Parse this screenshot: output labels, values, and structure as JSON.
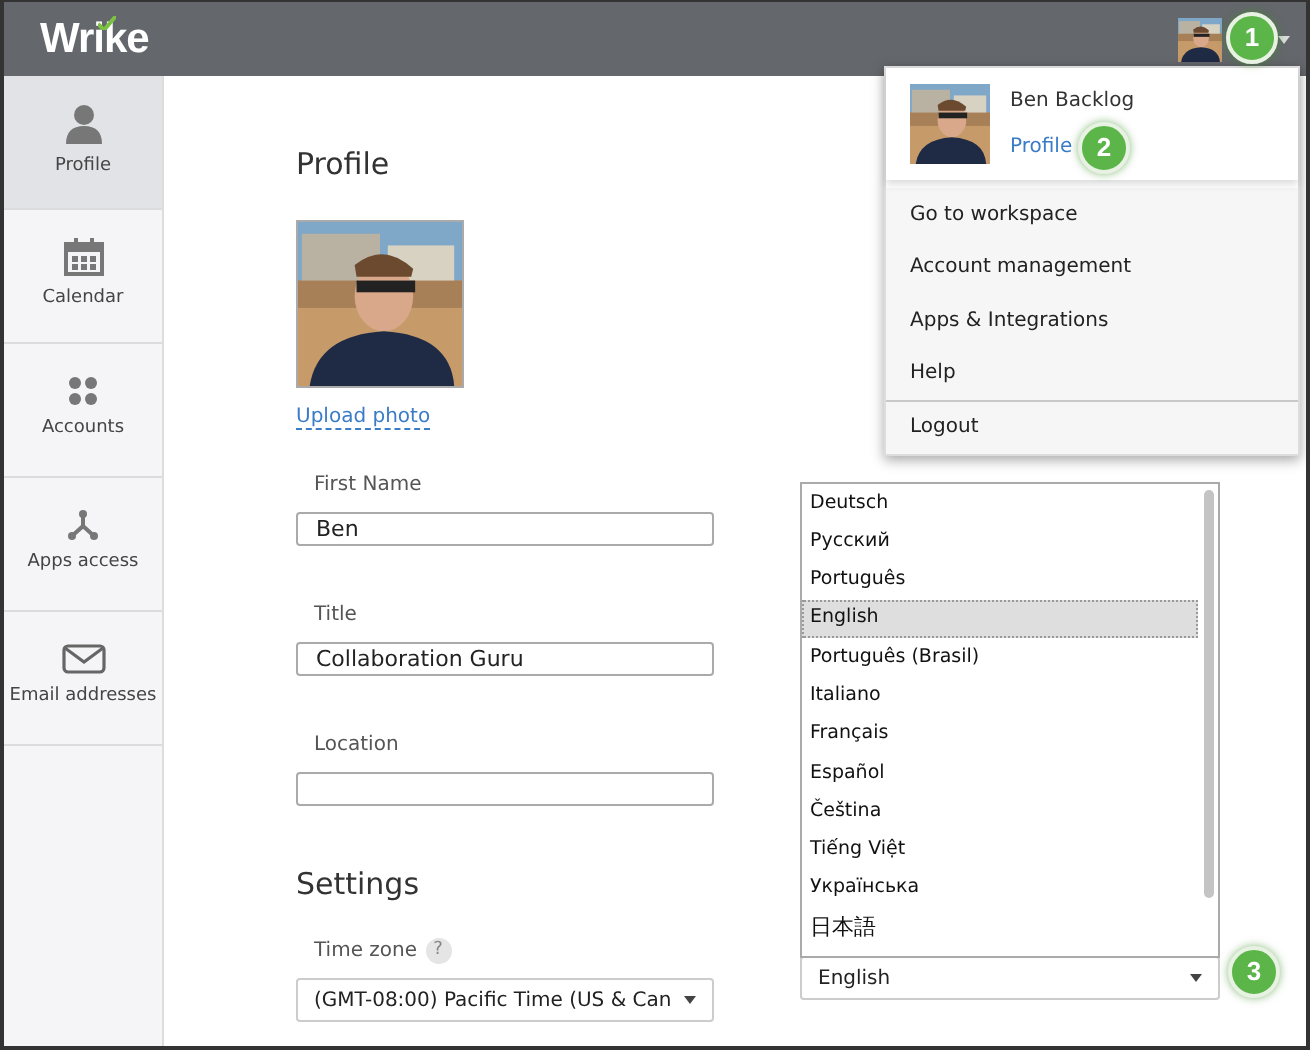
{
  "header": {
    "logo": "Wrike"
  },
  "sidebar": {
    "items": [
      {
        "label": "Profile",
        "kind": "person",
        "selected": true
      },
      {
        "label": "Calendar",
        "kind": "calendar",
        "selected": false
      },
      {
        "label": "Accounts",
        "kind": "dots",
        "selected": false
      },
      {
        "label": "Apps access",
        "kind": "apps",
        "selected": false
      },
      {
        "label": "Email addresses",
        "kind": "mail",
        "selected": false
      }
    ]
  },
  "profile": {
    "heading": "Profile",
    "upload_link": "Upload photo",
    "fields": [
      {
        "label": "First Name",
        "value": "Ben"
      },
      {
        "label": "Title",
        "value": "Collaboration Guru"
      },
      {
        "label": "Location"
      }
    ]
  },
  "settings": {
    "heading": "Settings",
    "timezone": {
      "label": "Time zone",
      "help": "?",
      "value": "(GMT-08:00) Pacific Time (US & Can"
    },
    "language": {
      "value": "English",
      "options": [
        {
          "label": "Deutsch",
          "selected": false
        },
        {
          "label": "Русский",
          "selected": false
        },
        {
          "label": "Português",
          "selected": false
        },
        {
          "label": "English",
          "selected": true
        },
        {
          "label": "Português (Brasil)",
          "selected": false
        },
        {
          "label": "Italiano",
          "selected": false
        },
        {
          "label": "Français",
          "selected": false
        },
        {
          "label": "Español",
          "selected": false
        },
        {
          "label": "Čeština",
          "selected": false
        },
        {
          "label": "Tiếng Việt",
          "selected": false
        },
        {
          "label": "Українська",
          "selected": false
        },
        {
          "label": "日本語",
          "selected": false
        }
      ]
    }
  },
  "user_menu": {
    "name": "Ben Backlog",
    "profile_link": "Profile",
    "items": [
      {
        "label": "Go to workspace",
        "divider": false
      },
      {
        "label": "Account management",
        "divider": false
      },
      {
        "label": "Apps & Integrations",
        "divider": false
      },
      {
        "label": "Help",
        "divider": false
      },
      {
        "label": "Logout",
        "divider": true
      }
    ]
  },
  "callouts": [
    "1",
    "2",
    "3"
  ]
}
